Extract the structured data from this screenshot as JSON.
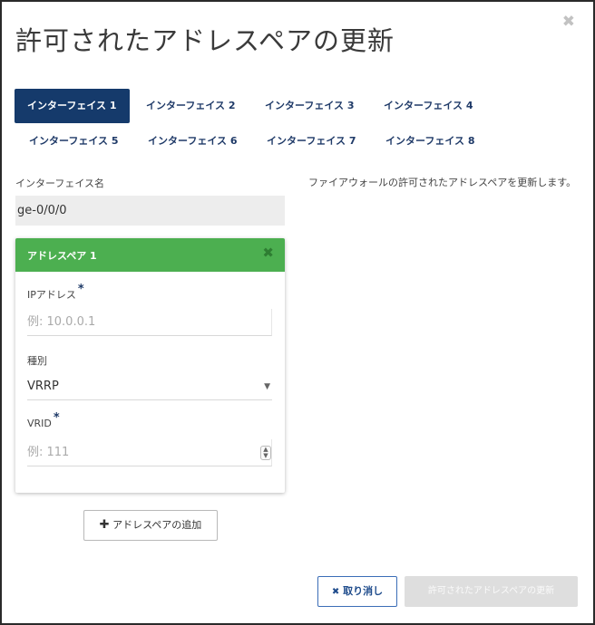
{
  "dialog": {
    "title": "許可されたアドレスペアの更新",
    "close_glyph": "✖"
  },
  "tabs": [
    {
      "label": "インターフェイス 1",
      "active": true
    },
    {
      "label": "インターフェイス 2",
      "active": false
    },
    {
      "label": "インターフェイス 3",
      "active": false
    },
    {
      "label": "インターフェイス 4",
      "active": false
    },
    {
      "label": "インターフェイス 5",
      "active": false
    },
    {
      "label": "インターフェイス 6",
      "active": false
    },
    {
      "label": "インターフェイス 7",
      "active": false
    },
    {
      "label": "インターフェイス 8",
      "active": false
    }
  ],
  "interface": {
    "name_label": "インターフェイス名",
    "name_value": "ge-0/0/0"
  },
  "description": "ファイアウォールの許可されたアドレスペアを更新します。",
  "address_pair": {
    "title": "アドレスペア 1",
    "remove_glyph": "✖",
    "ip_label": "IPアドレス",
    "ip_placeholder": "例: 10.0.0.1",
    "type_label": "種別",
    "type_value": "VRRP",
    "vrid_label": "VRID",
    "vrid_placeholder": "例: 111",
    "required_mark": "*"
  },
  "buttons": {
    "add_label": "アドレスペアの追加",
    "cancel_label": "取り消し",
    "update_label": "許可されたアドレスペアの更新"
  },
  "colors": {
    "active_tab": "#153a6b",
    "card_header": "#4caf50",
    "tab_text": "#1f3a68"
  }
}
